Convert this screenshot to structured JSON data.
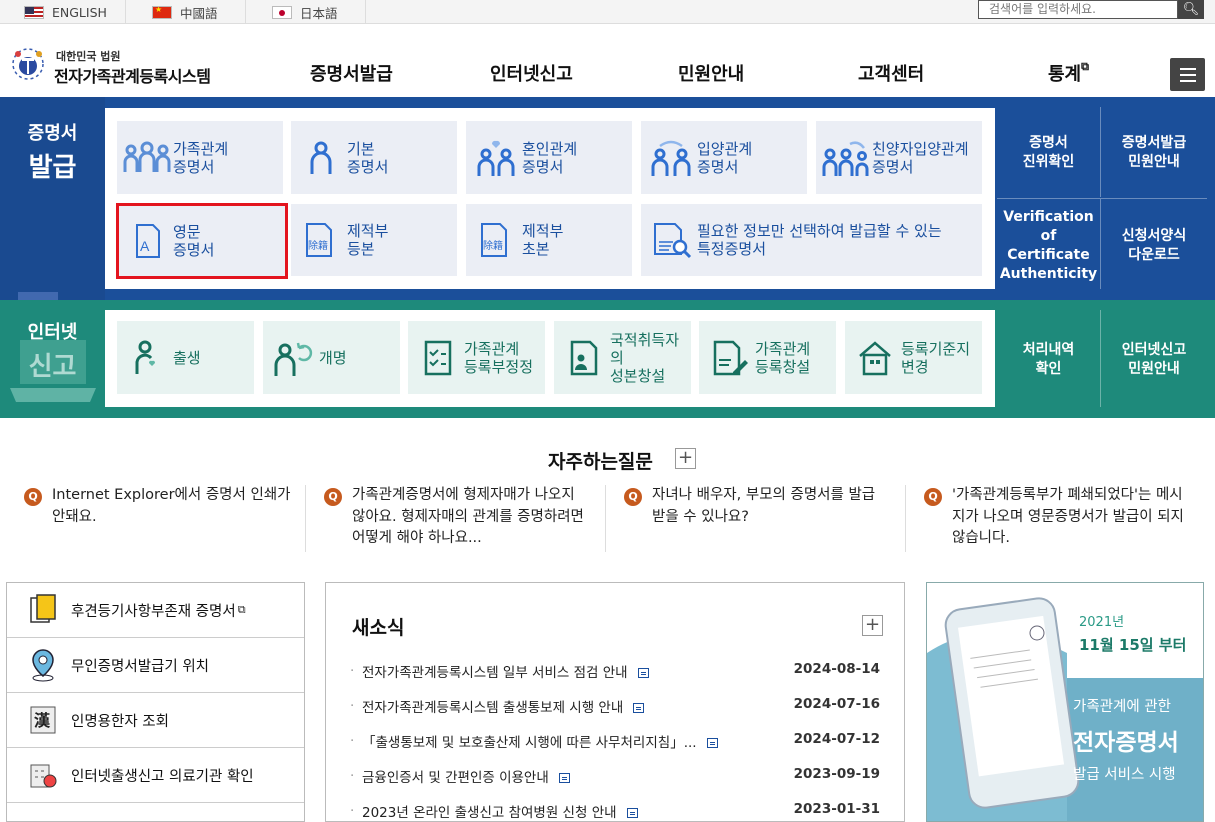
{
  "languages": [
    {
      "label": "ENGLISH",
      "flag": "us-flag-icon"
    },
    {
      "label": "中國語",
      "flag": "cn-flag-icon"
    },
    {
      "label": "日本語",
      "flag": "jp-flag-icon"
    }
  ],
  "search": {
    "placeholder": "검색어를 입력하세요."
  },
  "logo": {
    "sub": "대한민국 법원",
    "main": "전자가족관계등록시스템"
  },
  "gnb": [
    "증명서발급",
    "인터넷신고",
    "민원안내",
    "고객센터",
    "통계"
  ],
  "issue": {
    "title_a": "증명서",
    "title_b": "발급",
    "tiles": [
      "가족관계\n증명서",
      "기본\n증명서",
      "혼인관계\n증명서",
      "입양관계\n증명서",
      "친양자입양관계\n증명서",
      "영문\n증명서",
      "제적부\n등본",
      "제적부\n초본",
      "필요한 정보만 선택하여 발급할 수 있는\n특정증명서"
    ],
    "side": [
      "증명서\n진위확인",
      "증명서발급\n민원안내",
      "Verification of\nCertificate\nAuthenticity",
      "신청서양식\n다운로드"
    ]
  },
  "report": {
    "title_a": "인터넷",
    "title_b": "신고",
    "tiles": [
      "출생",
      "개명",
      "가족관계\n등록부정정",
      "국적취득자의\n성본창설",
      "가족관계\n등록창설",
      "등록기준지\n변경"
    ],
    "side": [
      "처리내역\n확인",
      "인터넷신고\n민원안내"
    ]
  },
  "faq": {
    "title": "자주하는질문",
    "plus": "+",
    "items": [
      "Internet Explorer에서 증명서 인쇄가 안돼요.",
      "가족관계증명서에 형제자매가 나오지 않아요. 형제자매의 관계를 증명하려면 어떻게 해야 하나요...",
      "자녀나 배우자, 부모의 증명서를 발급 받을 수 있나요?",
      "'가족관계등록부가 폐쇄되었다'는 메시지가 나오며 영문증명서가 발급이 되지 않습니다."
    ]
  },
  "quick": [
    "후견등기사항부존재 증명서",
    "무인증명서발급기 위치",
    "인명용한자 조회",
    "인터넷출생신고 의료기관 확인"
  ],
  "news": {
    "title": "새소식",
    "plus": "+",
    "items": [
      {
        "title": "전자가족관계등록시스템 일부 서비스 점검 안내",
        "date": "2024-08-14"
      },
      {
        "title": "전자가족관계등록시스템 출생통보제 시행 안내",
        "date": "2024-07-16"
      },
      {
        "title": "「출생통보제 및 보호출산제 시행에 따른 사무처리지침」...",
        "date": "2024-07-12"
      },
      {
        "title": "금융인증서 및 간편인증 이용안내",
        "date": "2023-09-19"
      },
      {
        "title": "2023년 온라인 출생신고 참여병원 신청 안내",
        "date": "2023-01-31"
      }
    ]
  },
  "banner": {
    "year": "2021년",
    "date": "11월 15일 부터",
    "line1": "가족관계에 관한",
    "line2": "전자증명서",
    "line3": "발급 서비스 시행"
  }
}
